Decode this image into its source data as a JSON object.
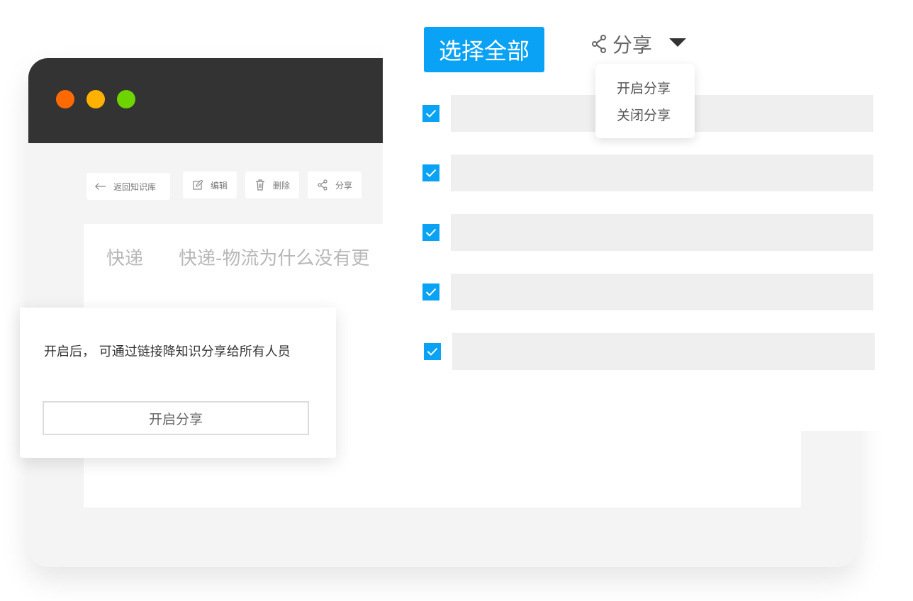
{
  "toolbar": {
    "back_label": "返回知识库",
    "edit_label": "编辑",
    "delete_label": "删除",
    "share_label": "分享"
  },
  "document": {
    "category": "快递",
    "title": "快递-物流为什么没有更"
  },
  "actions": {
    "select_all_label": "选择全部",
    "share_label": "分享"
  },
  "share_menu": {
    "items": [
      {
        "label": "开启分享"
      },
      {
        "label": "关闭分享"
      }
    ]
  },
  "rows": [
    {
      "checked": true
    },
    {
      "checked": true
    },
    {
      "checked": true
    },
    {
      "checked": true
    },
    {
      "checked": true
    }
  ],
  "dialog": {
    "message": "开启后， 可通过链接降知识分享给所有人员",
    "button_label": "开启分享"
  },
  "colors": {
    "accent": "#0aa2f5",
    "titlebar": "#333333",
    "dot_red": "#ff6a00",
    "dot_yellow": "#ffb100",
    "dot_green": "#6dd400"
  }
}
